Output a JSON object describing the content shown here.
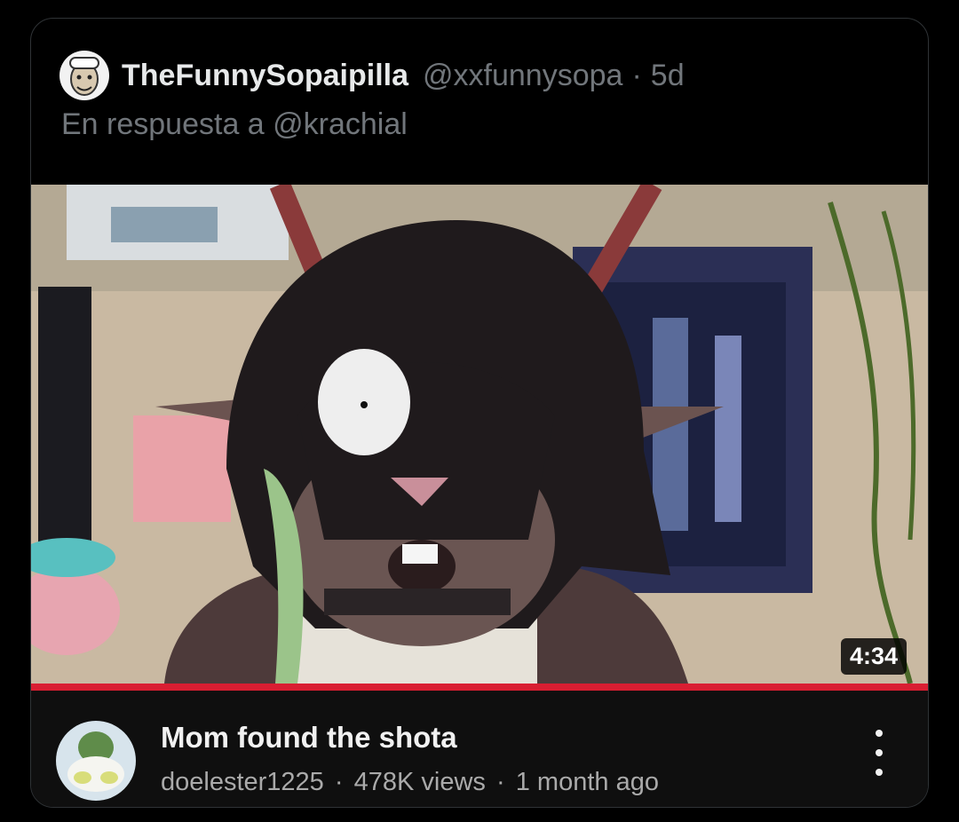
{
  "tweet": {
    "display_name": "TheFunnySopaipilla",
    "handle": "@xxfunnysopa",
    "separator": "·",
    "age": "5d",
    "reply_prefix": "En respuesta a",
    "reply_to": "@krachial"
  },
  "video": {
    "duration": "4:34",
    "title": "Mom found the shota",
    "channel": "doelester1225",
    "views": "478K views",
    "posted": "1 month ago",
    "meta_separator": "·",
    "progress_color": "#d91e32"
  },
  "colors": {
    "background": "#000000",
    "border": "#2f3336",
    "secondary_text": "#71767b"
  },
  "icons": {
    "more": "vertical-ellipsis-icon"
  }
}
